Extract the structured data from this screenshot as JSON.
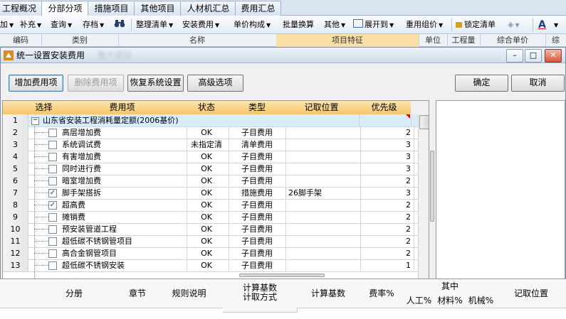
{
  "top_tabs": [
    "工程概况",
    "分部分项",
    "措施项目",
    "其他项目",
    "人材机汇总",
    "费用汇总"
  ],
  "active_tab": "分部分项",
  "toolbar": {
    "items": [
      "加",
      "补充",
      "查询",
      "存档",
      "",
      "整理清单",
      "安装费用",
      "单价构成",
      "批量换算",
      "其他",
      "展开到",
      "重用组价",
      "锁定清单",
      "",
      "A"
    ]
  },
  "bg_header": [
    "编码",
    "类别",
    "名称",
    "项目特征",
    "单位",
    "工程量",
    "综合单价",
    "综"
  ],
  "dialog": {
    "title": "统一设置安装费用",
    "title_blur": "整个项目",
    "window_buttons": [
      "–",
      "□",
      "✕"
    ],
    "buttons": {
      "add": "增加费用项",
      "delete": "删除费用项",
      "restore": "恢复系统设置",
      "advanced": "高级选项",
      "ok": "确定",
      "cancel": "取消"
    }
  },
  "grid": {
    "columns": [
      "选择",
      "费用项",
      "状态",
      "类型",
      "记取位置",
      "优先级"
    ],
    "group_row": {
      "num": "1",
      "label": "山东省安装工程消耗量定额(2006基价)"
    },
    "rows": [
      {
        "num": "2",
        "checked": false,
        "name": "高层增加费",
        "status": "OK",
        "type": "子目费用",
        "loc": "",
        "priority": "2"
      },
      {
        "num": "3",
        "checked": false,
        "name": "系统调试费",
        "status": "未指定清",
        "type": "清单费用",
        "loc": "",
        "priority": "3"
      },
      {
        "num": "4",
        "checked": false,
        "name": "有害增加费",
        "status": "OK",
        "type": "子目费用",
        "loc": "",
        "priority": "3"
      },
      {
        "num": "5",
        "checked": false,
        "name": "同时进行费",
        "status": "OK",
        "type": "子目费用",
        "loc": "",
        "priority": "3"
      },
      {
        "num": "6",
        "checked": false,
        "name": "暗室增加费",
        "status": "OK",
        "type": "子目费用",
        "loc": "",
        "priority": "2"
      },
      {
        "num": "7",
        "checked": true,
        "name": "脚手架搭拆",
        "status": "OK",
        "type": "措施费用",
        "loc": "26脚手架",
        "priority": "3"
      },
      {
        "num": "8",
        "checked": true,
        "name": "超高费",
        "status": "OK",
        "type": "子目费用",
        "loc": "",
        "priority": "2"
      },
      {
        "num": "9",
        "checked": false,
        "name": "摊销费",
        "status": "OK",
        "type": "子目费用",
        "loc": "",
        "priority": "2"
      },
      {
        "num": "10",
        "checked": false,
        "name": "预安装管道工程",
        "status": "OK",
        "type": "子目费用",
        "loc": "",
        "priority": "2"
      },
      {
        "num": "11",
        "checked": false,
        "name": "超低碳不锈钢管项目",
        "status": "OK",
        "type": "子目费用",
        "loc": "",
        "priority": "2"
      },
      {
        "num": "12",
        "checked": false,
        "name": "高合金钢管项目",
        "status": "OK",
        "type": "子目费用",
        "loc": "",
        "priority": "2"
      },
      {
        "num": "13",
        "checked": false,
        "name": "超低碳不锈钢安装",
        "status": "OK",
        "type": "子目费用",
        "loc": "",
        "priority": "1"
      }
    ]
  },
  "bottom_header": {
    "fenche": "分册",
    "zhangjie": "章节",
    "rule": "规则说明",
    "calc_mode_1": "计算基数",
    "calc_mode_2": "计取方式",
    "base": "计算基数",
    "rate": "费率%",
    "among": "其中",
    "labor": "人工%",
    "material": "材料%",
    "machine": "机械%",
    "loc": "记取位置"
  }
}
